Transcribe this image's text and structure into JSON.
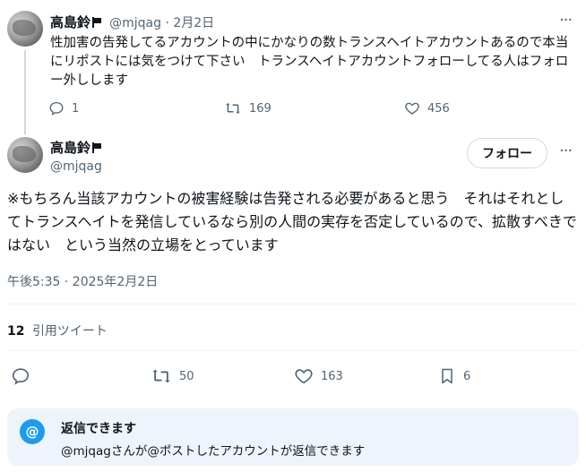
{
  "reply_tweet": {
    "author_name": "高島鈴",
    "handle_date": "@mjqag · 2月2日",
    "text": "性加害の告発してるアカウントの中にかなりの数トランスヘイトアカウントあるので本当にリポストには気をつけて下さい　トランスヘイトアカウントフォローしてる人はフォロー外しします",
    "replies": "1",
    "reposts": "169",
    "likes": "456",
    "more": "···"
  },
  "main_tweet": {
    "author_name": "高島鈴",
    "handle": "@mjqag",
    "follow_label": "フォロー",
    "more": "···",
    "text": "※もちろん当該アカウントの被害経験は告発される必要があると思う　それはそれとしてトランスヘイトを発信しているなら別の人間の実存を否定しているので、拡散すべきではない　という当然の立場をとっています",
    "timestamp": "午後5:35 · 2025年2月2日",
    "quote_count": "12",
    "quote_label": "引用ツイート",
    "reposts": "50",
    "likes": "163",
    "bookmarks": "6"
  },
  "reply_notice": {
    "badge": "@",
    "title": "返信できます",
    "body": "@mjqagさんが@ポストしたアカウントが返信できます"
  },
  "colors": {
    "text": "#0f1419",
    "muted": "#536471",
    "accent": "#1d9bf0",
    "notice_bg": "#eef4fb"
  }
}
